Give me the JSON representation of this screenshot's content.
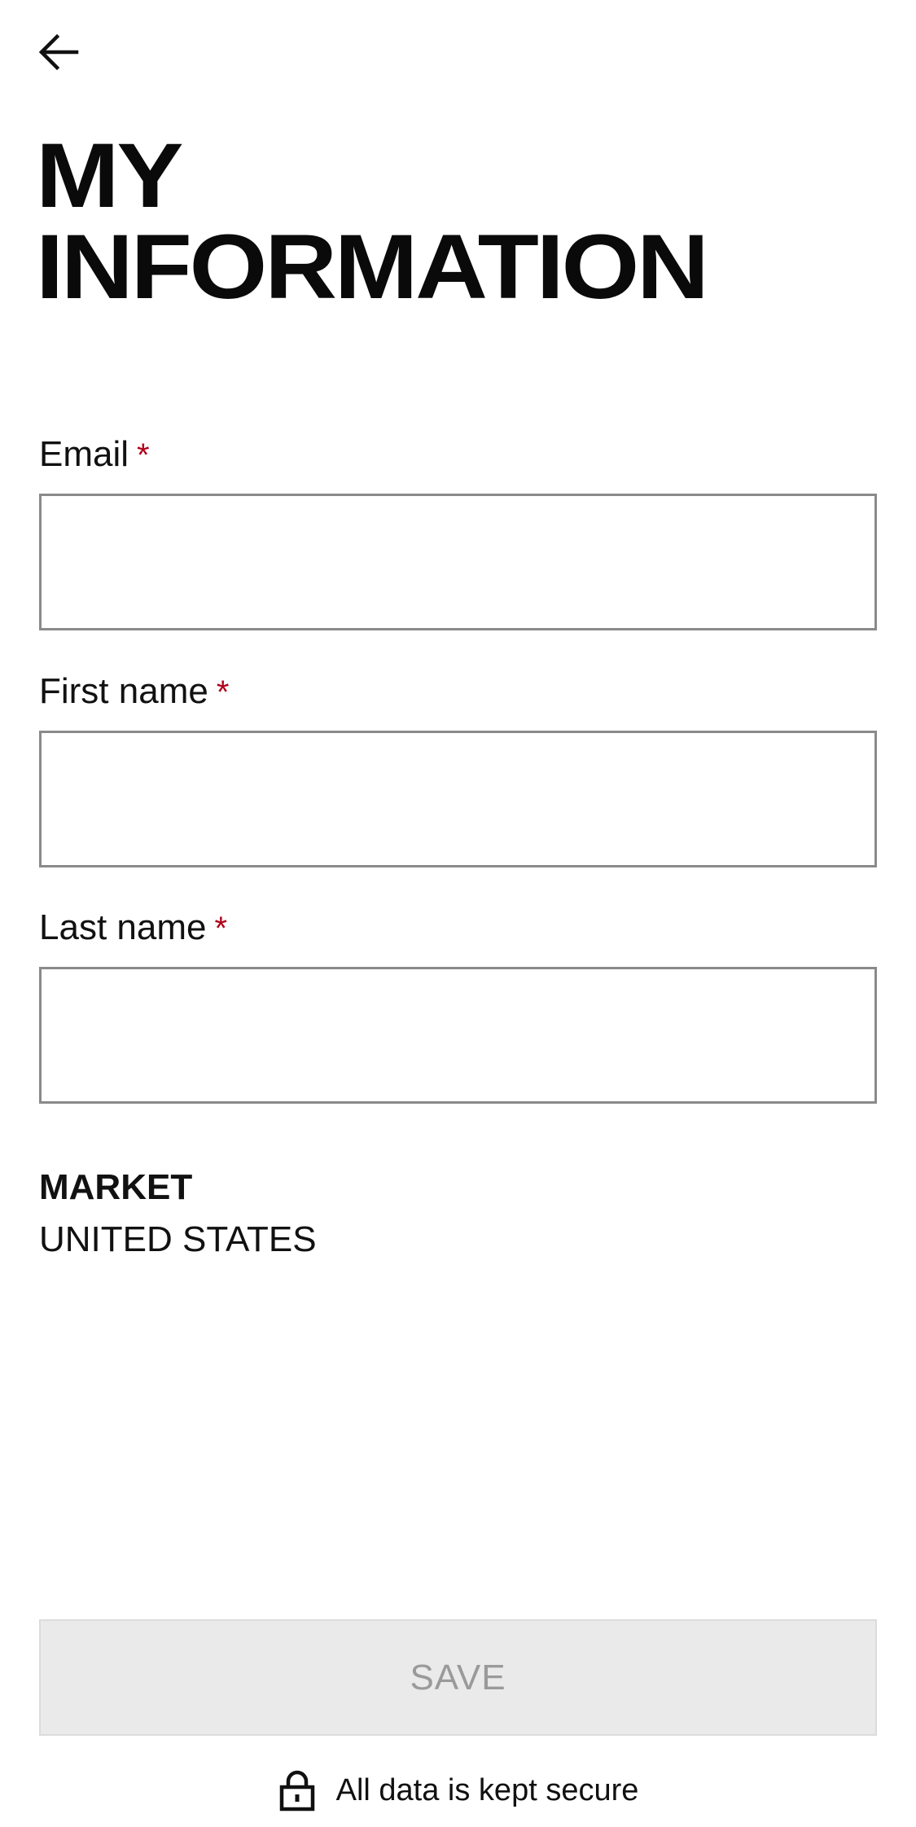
{
  "header": {
    "back_icon": "arrow-left-icon",
    "title_line1": "MY",
    "title_line2": "INFORMATION"
  },
  "form": {
    "email": {
      "label": "Email",
      "required_mark": "*",
      "value": "",
      "placeholder": ""
    },
    "first_name": {
      "label": "First name",
      "required_mark": "*",
      "value": "",
      "placeholder": ""
    },
    "last_name": {
      "label": "Last name",
      "required_mark": "*",
      "value": "",
      "placeholder": ""
    }
  },
  "market": {
    "label": "MARKET",
    "value": "UNITED STATES"
  },
  "actions": {
    "save_label": "SAVE"
  },
  "footer": {
    "secure_icon": "lock-icon",
    "secure_text": "All data is kept secure"
  },
  "colors": {
    "required": "#b0001a",
    "input_border": "#8a8a8a",
    "save_disabled_bg": "#eaeaea",
    "save_disabled_text": "#9a9a9a"
  }
}
